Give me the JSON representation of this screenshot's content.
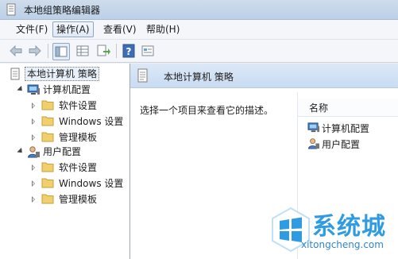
{
  "window": {
    "title": "本地组策略编辑器"
  },
  "menubar": {
    "items": [
      {
        "label": "文件(F)"
      },
      {
        "label": "操作(A)"
      },
      {
        "label": "查看(V)"
      },
      {
        "label": "帮助(H)"
      }
    ]
  },
  "toolbar": {
    "buttons": [
      "back-icon",
      "forward-icon",
      "show-hide-tree-icon",
      "grid-icon",
      "export-list-icon",
      "help-icon",
      "properties-icon"
    ]
  },
  "tree": {
    "root": {
      "label": "本地计算机 策略"
    },
    "computer": {
      "label": "计算机配置",
      "children": [
        {
          "label": "软件设置"
        },
        {
          "label": "Windows 设置"
        },
        {
          "label": "管理模板"
        }
      ]
    },
    "user": {
      "label": "用户配置",
      "children": [
        {
          "label": "软件设置"
        },
        {
          "label": "Windows 设置"
        },
        {
          "label": "管理模板"
        }
      ]
    }
  },
  "content": {
    "header_title": "本地计算机 策略",
    "description": "选择一个项目来查看它的描述。",
    "list": {
      "column_name": "名称",
      "items": [
        {
          "label": "计算机配置"
        },
        {
          "label": "用户配置"
        }
      ]
    }
  },
  "watermark": {
    "name": "系统城",
    "url": "xitongcheng.com"
  },
  "colors": {
    "header_gradient": "#c9dcf2",
    "folder": "#e8c35a",
    "watermark": "#2f9be0"
  }
}
